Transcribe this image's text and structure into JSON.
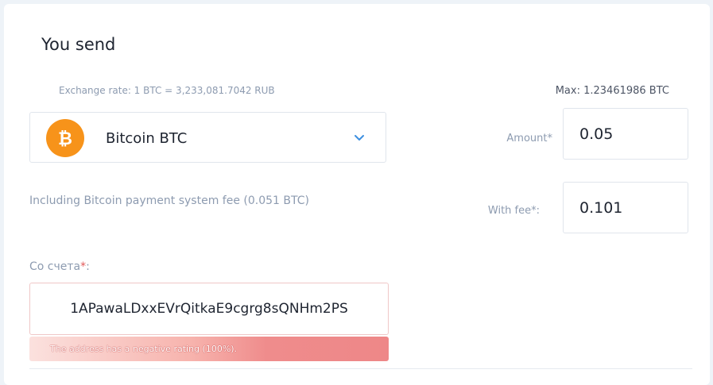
{
  "form": {
    "title": "You send",
    "exchange_rate": "Exchange rate: 1 BTC = 3,233,081.7042 RUB",
    "max": "Max: 1.23461986 BTC",
    "currency": {
      "name": "Bitcoin BTC",
      "icon": "bitcoin-icon",
      "icon_glyph": "₿",
      "color": "#f7931a"
    },
    "amount_label": "Amount*",
    "amount_value": "0.05",
    "with_fee_label": "With fee*:",
    "with_fee_value": "0.101",
    "fee_note": "Including Bitcoin payment system fee (0.051 BTC)",
    "account_label": "Со счета",
    "account_required": "*",
    "account_label_suffix": ":",
    "address_value": "1APawaLDxxEVrQitkaE9cgrg8sQNHm2PS",
    "error": "The address has a negative rating (100%)."
  },
  "colors": {
    "accent": "#3d8fe0",
    "error": "#ee8788",
    "bitcoin": "#f7931a"
  }
}
